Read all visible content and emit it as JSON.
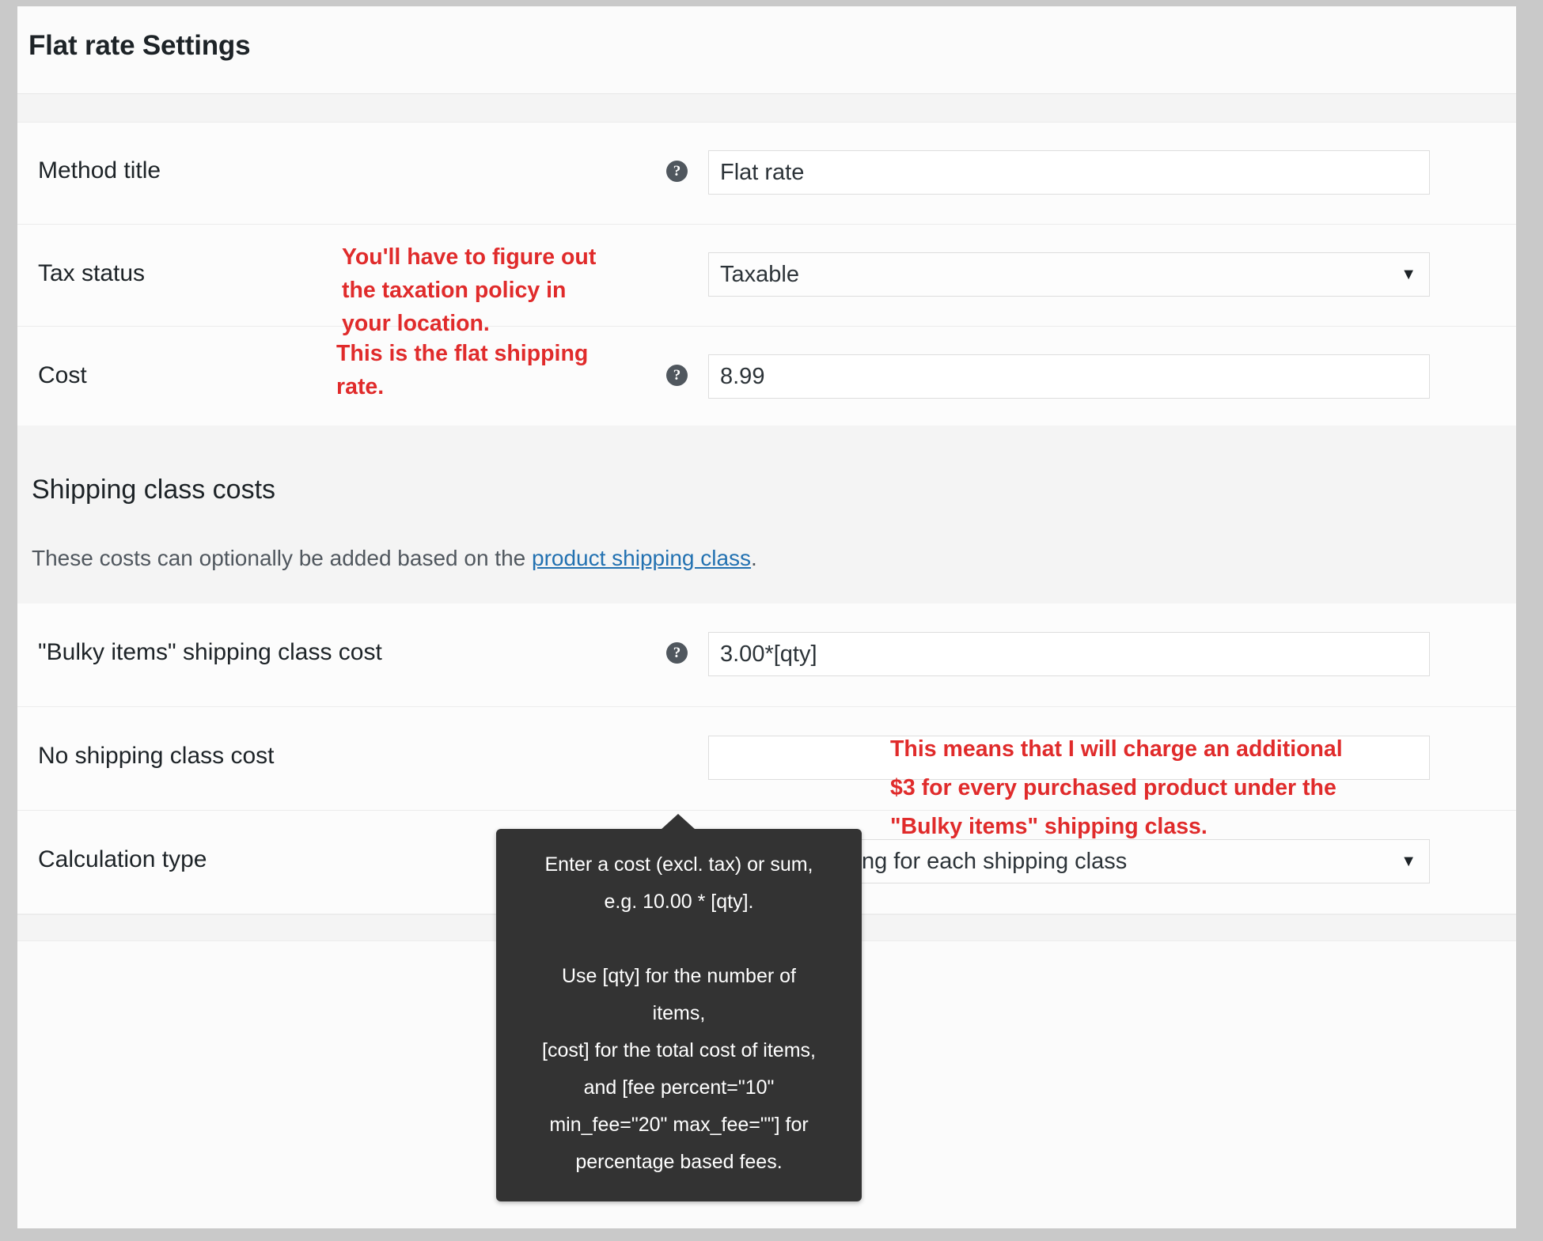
{
  "panel": {
    "title": "Flat rate Settings"
  },
  "settings_rows": [
    {
      "label": "Method title",
      "help_icon": "help-circle-icon",
      "control": "text",
      "value": "Flat rate"
    },
    {
      "label": "Tax status",
      "control": "select",
      "value": "Taxable",
      "caret": "▼"
    },
    {
      "label": "Cost",
      "help_icon": "help-circle-icon",
      "control": "text",
      "value": "8.99"
    }
  ],
  "annotations": [
    {
      "id": "tax-status-note",
      "lines": [
        "You'll have to figure out",
        "the taxation policy in",
        "your location."
      ]
    },
    {
      "id": "cost-note",
      "lines": [
        "This is the flat shipping",
        "rate."
      ]
    },
    {
      "id": "bulky-items-note",
      "lines": [
        "This means that I will charge an additional",
        "$3 for every purchased product under the",
        "\"Bulky items\" shipping class."
      ]
    }
  ],
  "shipping_section": {
    "title": "Shipping class costs",
    "description_before": "These costs can optionally be added based on the ",
    "description_link": "product shipping class",
    "description_after": ".",
    "rows": [
      {
        "label": "\"Bulky items\" shipping class cost",
        "help_icon": "help-circle-icon",
        "control": "text",
        "value": "3.00*[qty]"
      },
      {
        "label": "No shipping class cost",
        "control": "text",
        "value": ""
      },
      {
        "label": "Calculation type",
        "control": "select",
        "value": "Charge shipping for each shipping class",
        "caret": "▼"
      }
    ]
  },
  "tooltip": {
    "lines": [
      "Enter a cost (excl. tax) or sum,",
      "e.g. 10.00 * [qty].",
      "",
      "Use [qty] for the number of",
      "items,",
      "[cost] for the total cost of items,",
      "and [fee percent=\"10\"",
      "min_fee=\"20\" max_fee=\"\"] for",
      "percentage based fees."
    ]
  },
  "colors": {
    "annotation_red": "#e02b2b",
    "link_blue": "#2271b1",
    "tooltip_bg": "#333333",
    "page_bg": "#fbfbfb",
    "outer_bg": "#c9c9c9"
  }
}
